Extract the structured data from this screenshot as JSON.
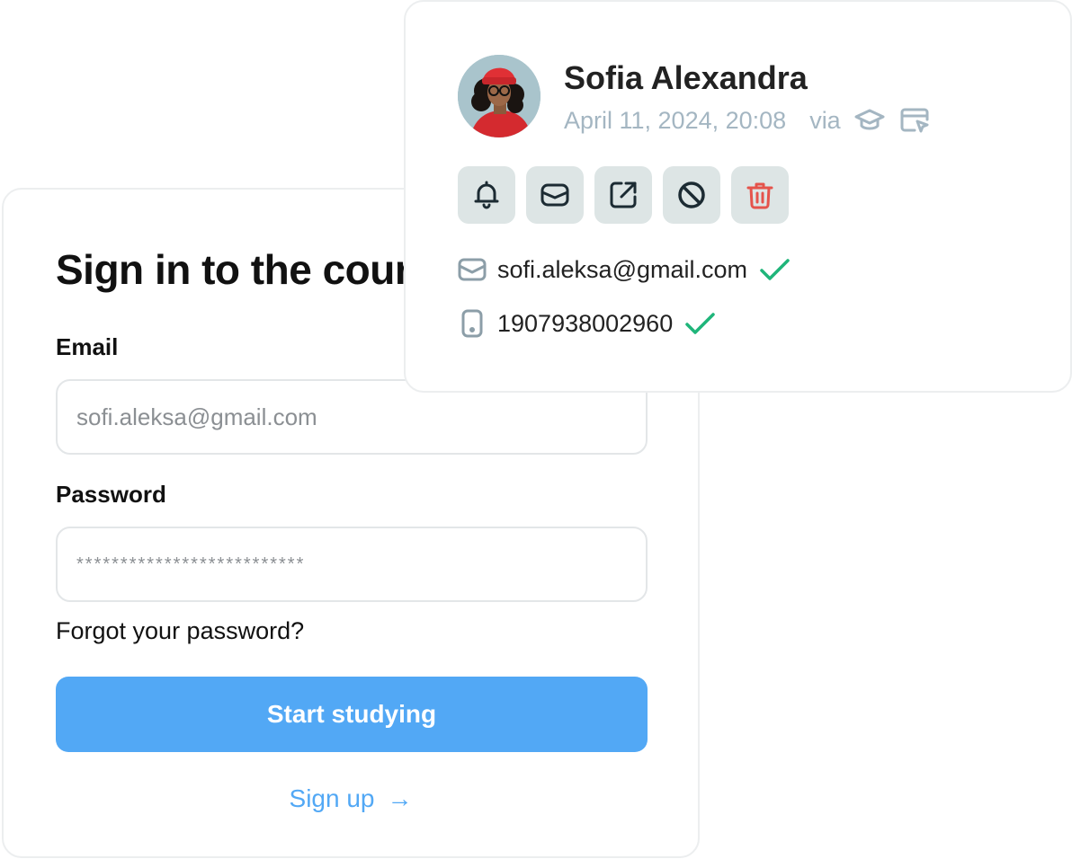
{
  "signin": {
    "title": "Sign in to the cour",
    "email_label": "Email",
    "email_placeholder": "sofi.aleksa@gmail.com",
    "password_label": "Password",
    "password_mask": "**************************",
    "forgot_link": "Forgot your password?",
    "submit_label": "Start studying",
    "signup_link": "Sign up",
    "signup_arrow": "→",
    "primary_color": "#52a8f5"
  },
  "profile": {
    "name": "Sofia Alexandra",
    "timestamp": "April 11, 2024, 20:08",
    "via_label": "via",
    "via_icons": [
      "graduation-cap-icon",
      "window-cursor-icon"
    ],
    "actions": [
      {
        "name": "notify-button",
        "icon": "bell-icon"
      },
      {
        "name": "message-button",
        "icon": "mail-icon"
      },
      {
        "name": "open-external-button",
        "icon": "external-link-icon"
      },
      {
        "name": "block-button",
        "icon": "ban-icon"
      },
      {
        "name": "delete-button",
        "icon": "trash-icon",
        "color": "#e5534b"
      }
    ],
    "email": "sofi.aleksa@gmail.com",
    "phone": "1907938002960",
    "verified_color": "#1fb57a"
  }
}
